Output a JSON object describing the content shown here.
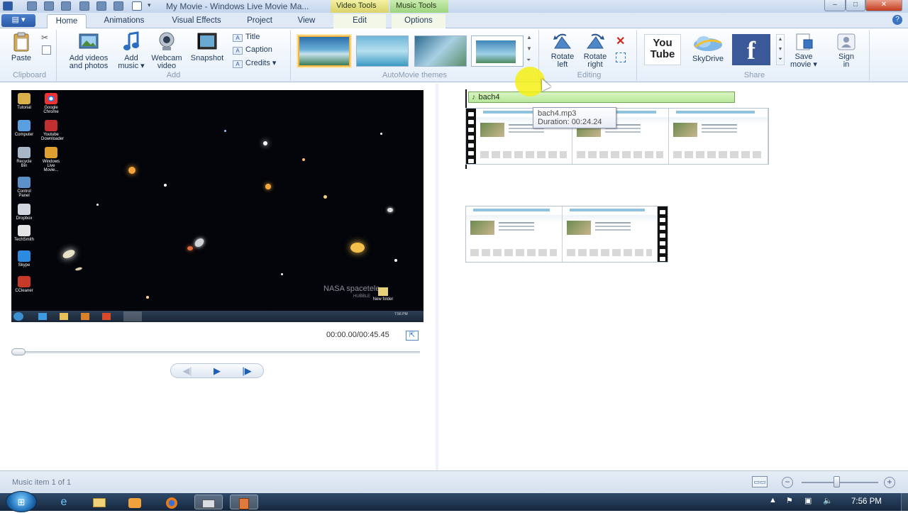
{
  "window": {
    "title": "My Movie - Windows Live Movie Ma...",
    "context_tabs": {
      "video": "Video Tools",
      "music": "Music Tools"
    },
    "controls": {
      "minimize": "–",
      "maximize": "□",
      "close": "✕"
    },
    "help": "?"
  },
  "tabs": [
    {
      "label": "Home"
    },
    {
      "label": "Animations"
    },
    {
      "label": "Visual Effects"
    },
    {
      "label": "Project"
    },
    {
      "label": "View"
    },
    {
      "label": "Edit"
    },
    {
      "label": "Options"
    }
  ],
  "ribbon": {
    "clipboard": {
      "label": "Clipboard",
      "paste": "Paste"
    },
    "add": {
      "label": "Add",
      "add_videos_line1": "Add videos",
      "add_videos_line2": "and photos",
      "add_music_line1": "Add",
      "add_music_line2": "music ▾",
      "webcam_line1": "Webcam",
      "webcam_line2": "video",
      "snapshot": "Snapshot",
      "title": "Title",
      "caption": "Caption",
      "credits": "Credits ▾"
    },
    "themes": {
      "label": "AutoMovie themes"
    },
    "editing": {
      "label": "Editing",
      "rotate_left_line1": "Rotate",
      "rotate_left_line2": "left",
      "rotate_right_line1": "Rotate",
      "rotate_right_line2": "right"
    },
    "share": {
      "label": "Share",
      "youtube": "You Tube",
      "skydrive": "SkyDrive",
      "facebook": "f",
      "save_movie_line1": "Save",
      "save_movie_line2": "movie ▾",
      "sign_in_line1": "Sign",
      "sign_in_line2": "in"
    }
  },
  "preview": {
    "time": "00:00.00/00:45.45",
    "seek_fraction": 0.0
  },
  "desktop_icons": [
    "Tutorial",
    "Google Chrome",
    "Computer",
    "Youtube Downloader",
    "Recycle Bin",
    "Windows Live Movie...",
    "Control Panel",
    "Dropbox",
    "TechSmith",
    "Skype",
    "CCleaner"
  ],
  "desktop_overlay": {
    "nasa": "NASA spacetele...",
    "hubble": "HUBBLE",
    "folder": "New folder",
    "clock": "7:56 PM"
  },
  "storyboard": {
    "music_item": "bach4",
    "tooltip_line1": "bach4.mp3",
    "tooltip_line2": "Duration: 00:24.24"
  },
  "status": {
    "text": "Music item 1 of 1",
    "zoom_fraction": 0.45
  },
  "taskbar": {
    "clock": "7:56 PM"
  }
}
